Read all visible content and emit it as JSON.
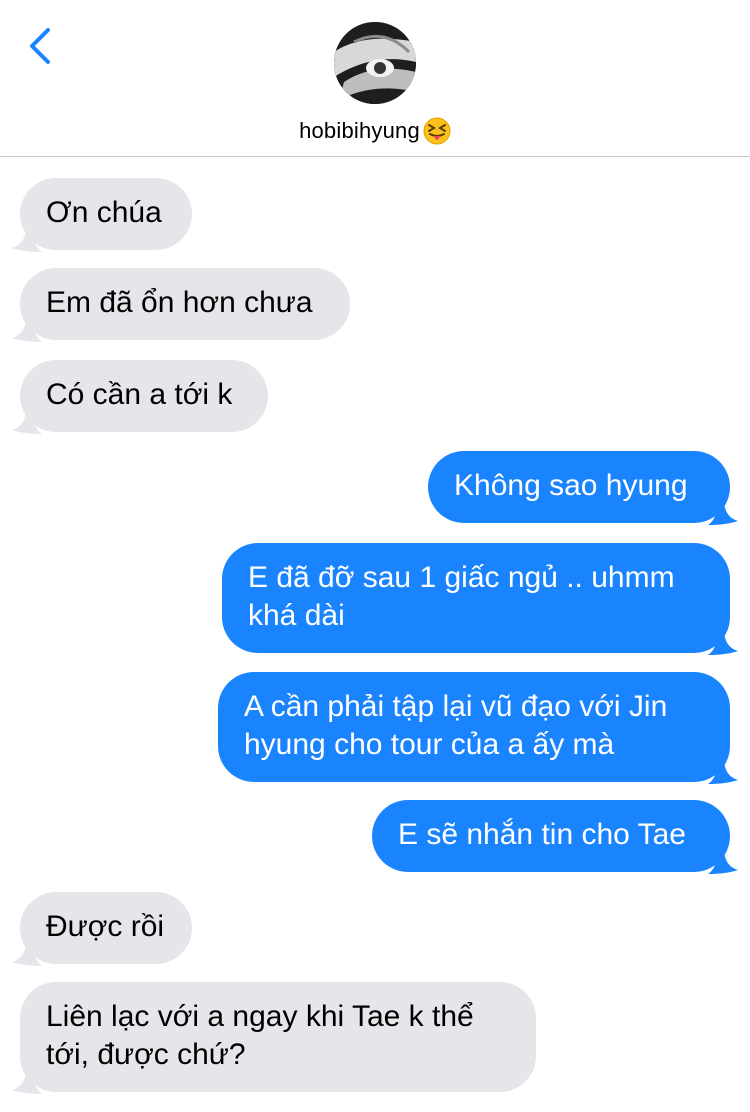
{
  "header": {
    "contact_name": "hobibihyung",
    "back_icon": "chevron-left-icon",
    "emoji_icon": "squinting-face-with-tongue-icon",
    "accent_color": "#1a84ff"
  },
  "messages": [
    {
      "direction": "incoming",
      "text": "Ơn chúa"
    },
    {
      "direction": "incoming",
      "text": "Em đã ổn hơn chưa"
    },
    {
      "direction": "incoming",
      "text": "Có cần a tới k"
    },
    {
      "direction": "outgoing",
      "text": "Không sao hyung"
    },
    {
      "direction": "outgoing",
      "lines": [
        "E đã đỡ sau 1 giấc ngủ .. uhmm",
        "khá dài"
      ]
    },
    {
      "direction": "outgoing",
      "lines": [
        "A cần phải tập lại vũ đạo với Jin",
        "hyung cho tour của a ấy mà"
      ]
    },
    {
      "direction": "outgoing",
      "text": "E sẽ nhắn tin cho Tae"
    },
    {
      "direction": "incoming",
      "text": "Được rồi"
    },
    {
      "direction": "incoming",
      "lines": [
        "Liên lạc với a ngay khi Tae k thể",
        "tới, được chứ?"
      ]
    }
  ],
  "colors": {
    "incoming_bubble": "#e5e5ea",
    "outgoing_bubble": "#1a84ff"
  }
}
